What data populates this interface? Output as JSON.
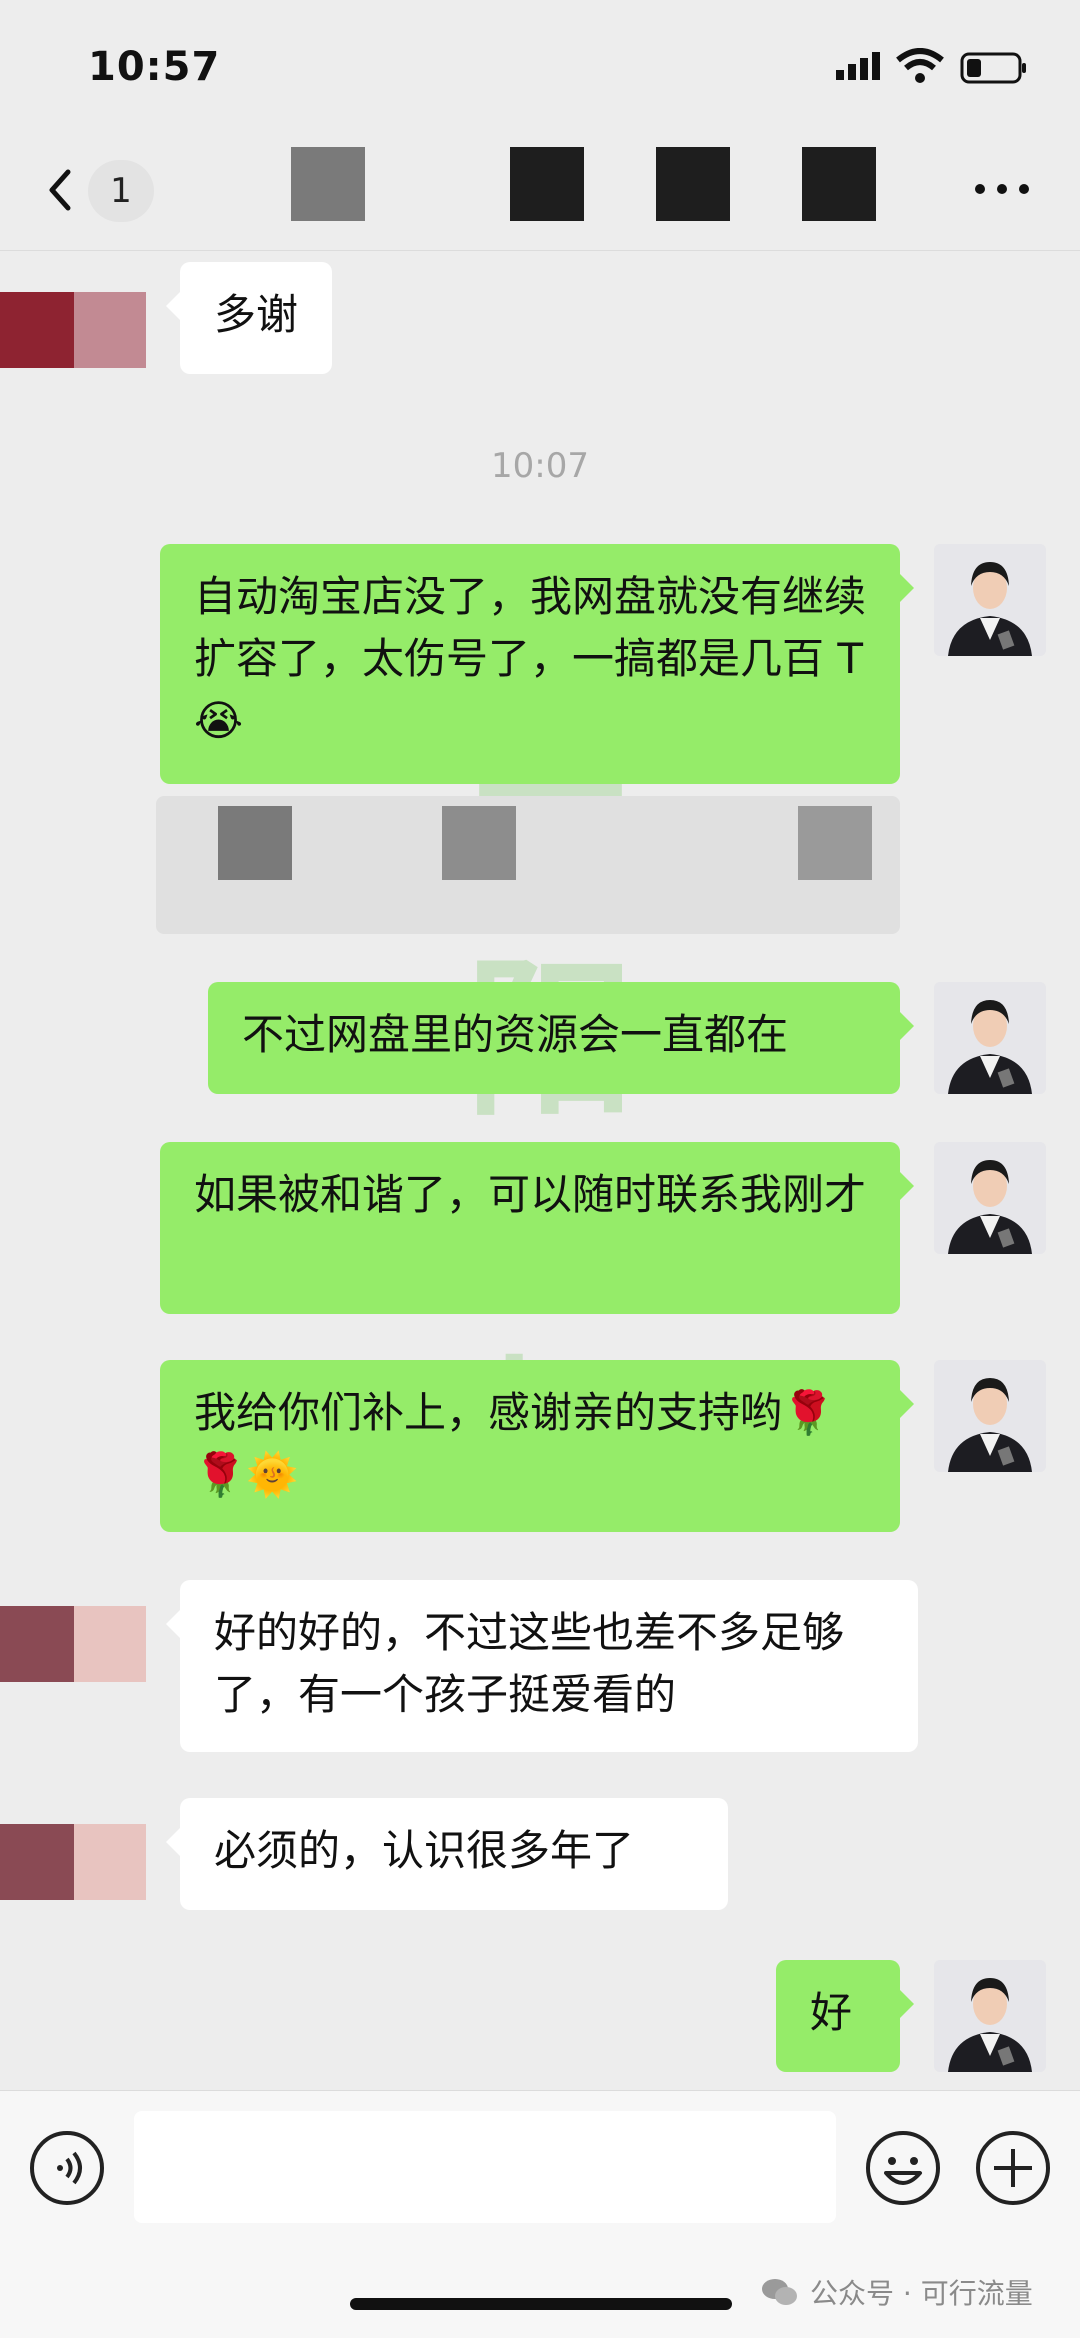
{
  "status_bar": {
    "time": "10:57"
  },
  "nav": {
    "unread_count": "1"
  },
  "timestamps": {
    "divider": "10:07"
  },
  "messages": [
    {
      "side": "in",
      "text": "多谢"
    },
    {
      "side": "out",
      "text": "自动淘宝店没了，我网盘就没有继续扩容了，太伤号了，一搞都是几百 T😭"
    },
    {
      "side": "out",
      "text": "不过网盘里的资源会一直都在"
    },
    {
      "side": "out",
      "text": "如果被和谐了，可以随时联系我刚才"
    },
    {
      "side": "out",
      "text": "我给你们补上，感谢亲的支持哟🌹🌹🌞"
    },
    {
      "side": "in",
      "text": "好的好的，不过这些也差不多足够了，有一个孩子挺爱看的"
    },
    {
      "side": "in",
      "text": "必须的，认识很多年了"
    },
    {
      "side": "out",
      "text": "好"
    }
  ],
  "watermark": {
    "text": "向阳老师"
  },
  "footer": {
    "source": "公众号 · 可行流量"
  },
  "colors": {
    "outgoing_bubble": "#95ec69",
    "incoming_bubble": "#ffffff",
    "background": "#ededed"
  }
}
